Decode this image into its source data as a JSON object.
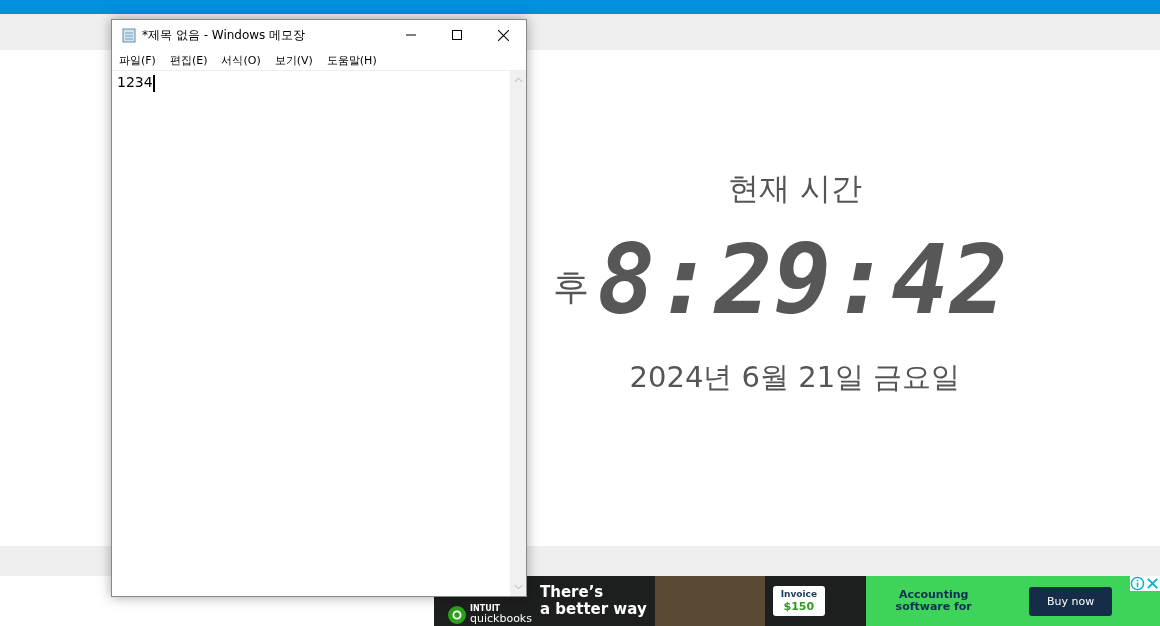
{
  "notepad": {
    "title": "*제목 없음 - Windows 메모장",
    "menu": [
      "파일(F)",
      "편집(E)",
      "서식(O)",
      "보기(V)",
      "도움말(H)"
    ],
    "content": "1234"
  },
  "clock": {
    "heading": "현재 시간",
    "meridiem": "후",
    "time": "8:29:42",
    "date": "2024년 6월 21일 금요일"
  },
  "ad": {
    "brand_top": "INTUIT",
    "brand": "quickbooks",
    "headline": [
      "There’s",
      "a better way"
    ],
    "invoice_title": "Invoice",
    "invoice_amount": "$150",
    "tagline": "Accounting software for",
    "button": "Buy now"
  }
}
